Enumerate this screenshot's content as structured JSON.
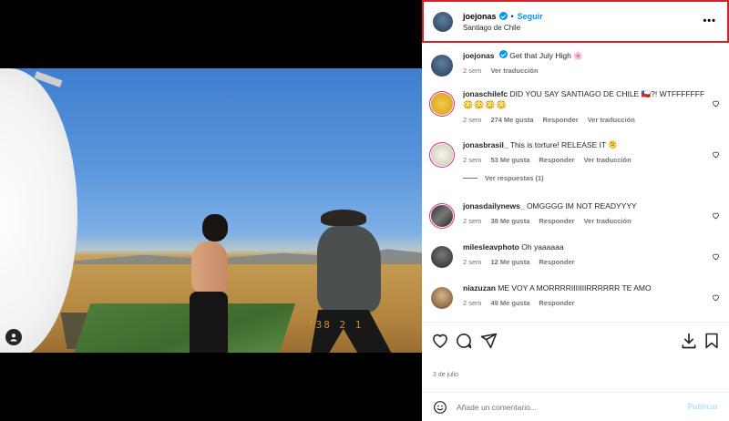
{
  "post": {
    "username": "joejonas",
    "follow_label": "Seguir",
    "location": "Santiago de Chile",
    "more_icon": "more-horizontal-icon",
    "photo_stamp": "'38 2 1",
    "date": "3 de julio"
  },
  "caption": {
    "username": "joejonas",
    "text": "Get that July High",
    "emoji": "🌸",
    "time": "2 sem",
    "translate": "Ver traducción"
  },
  "comments": [
    {
      "username": "jonaschilefc",
      "text": "DID YOU SAY SANTIAGO DE CHILE 🇨🇱?! WTFFFFFFF",
      "extra": "😳😳😳😳",
      "time": "2 sem",
      "likes": "274 Me gusta",
      "reply": "Responder",
      "translate": "Ver traducción"
    },
    {
      "username": "jonasbrasil_",
      "text": "This is torture! RELEASE IT 🫠",
      "time": "2 sem",
      "likes": "53 Me gusta",
      "reply": "Responder",
      "translate": "Ver traducción",
      "replies": "Ver respuestas (1)"
    },
    {
      "username": "jonasdailynews_",
      "text": "OMGGGG IM NOT READYYYY",
      "time": "2 sem",
      "likes": "38 Me gusta",
      "reply": "Responder",
      "translate": "Ver traducción"
    },
    {
      "username": "milesleavphoto",
      "text": "Oh yaaaaaa",
      "time": "2 sem",
      "likes": "12 Me gusta",
      "reply": "Responder"
    },
    {
      "username": "niazuzan",
      "text": "ME VOY A MORRRRIIIIIIIRRRRRR TE AMO",
      "time": "2 sem",
      "likes": "49 Me gusta",
      "reply": "Responder"
    }
  ],
  "composer": {
    "placeholder": "Añade un comentario...",
    "publish": "Publicar"
  },
  "icons": [
    "heart-icon",
    "comment-icon",
    "share-icon",
    "save-icon",
    "emoji-icon",
    "user-tag-icon",
    "verified-icon"
  ],
  "colors": {
    "accent": "#0095f6",
    "highlight_border": "#d3222a",
    "muted": "#737373"
  }
}
